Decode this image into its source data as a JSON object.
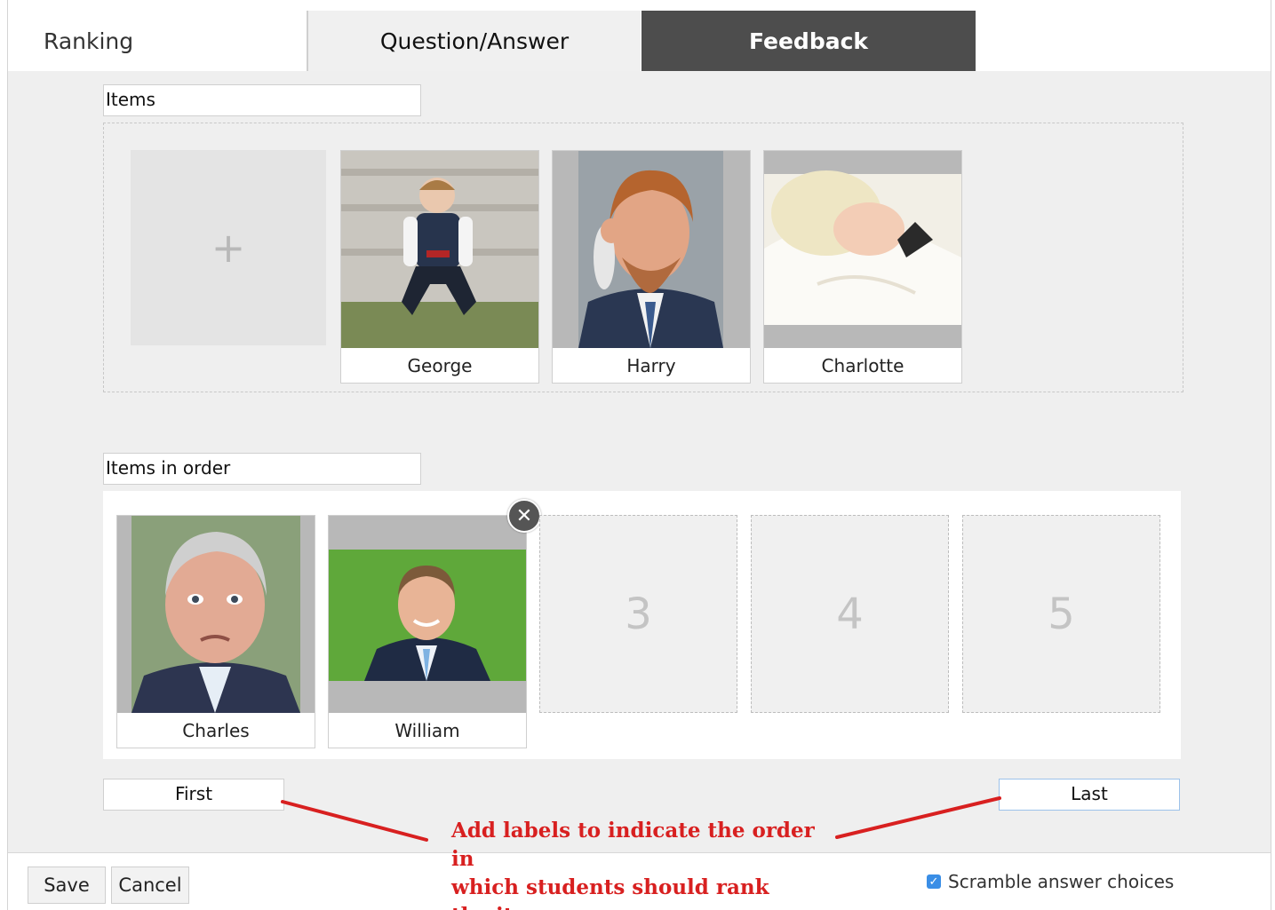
{
  "app": {
    "title": "Ranking"
  },
  "tabs": [
    {
      "label": "Question/Answer",
      "active": false
    },
    {
      "label": "Feedback",
      "active": true
    }
  ],
  "items_section": {
    "label_value": "Items",
    "add_glyph": "+",
    "cards": [
      {
        "caption": "George",
        "image": "photo-george"
      },
      {
        "caption": "Harry",
        "image": "photo-harry"
      },
      {
        "caption": "Charlotte",
        "image": "photo-charlotte"
      }
    ]
  },
  "order_section": {
    "label_value": "Items in order",
    "filled": [
      {
        "caption": "Charles",
        "image": "photo-charles"
      },
      {
        "caption": "William",
        "image": "photo-william"
      }
    ],
    "empty_slots": [
      "3",
      "4",
      "5"
    ],
    "remove_glyph": "✕",
    "first_label": "First",
    "last_label": "Last"
  },
  "annotation": {
    "line1": "Add labels to indicate the order in",
    "line2": "which students should rank",
    "line3": "the items",
    "color": "#d82020"
  },
  "footer": {
    "save_label": "Save",
    "cancel_label": "Cancel",
    "scramble_label": "Scramble answer choices",
    "scramble_checked": true
  },
  "colors": {
    "active_tab": "#4d4d4d",
    "panel": "#efefef",
    "checkbox": "#3a8ee6"
  }
}
